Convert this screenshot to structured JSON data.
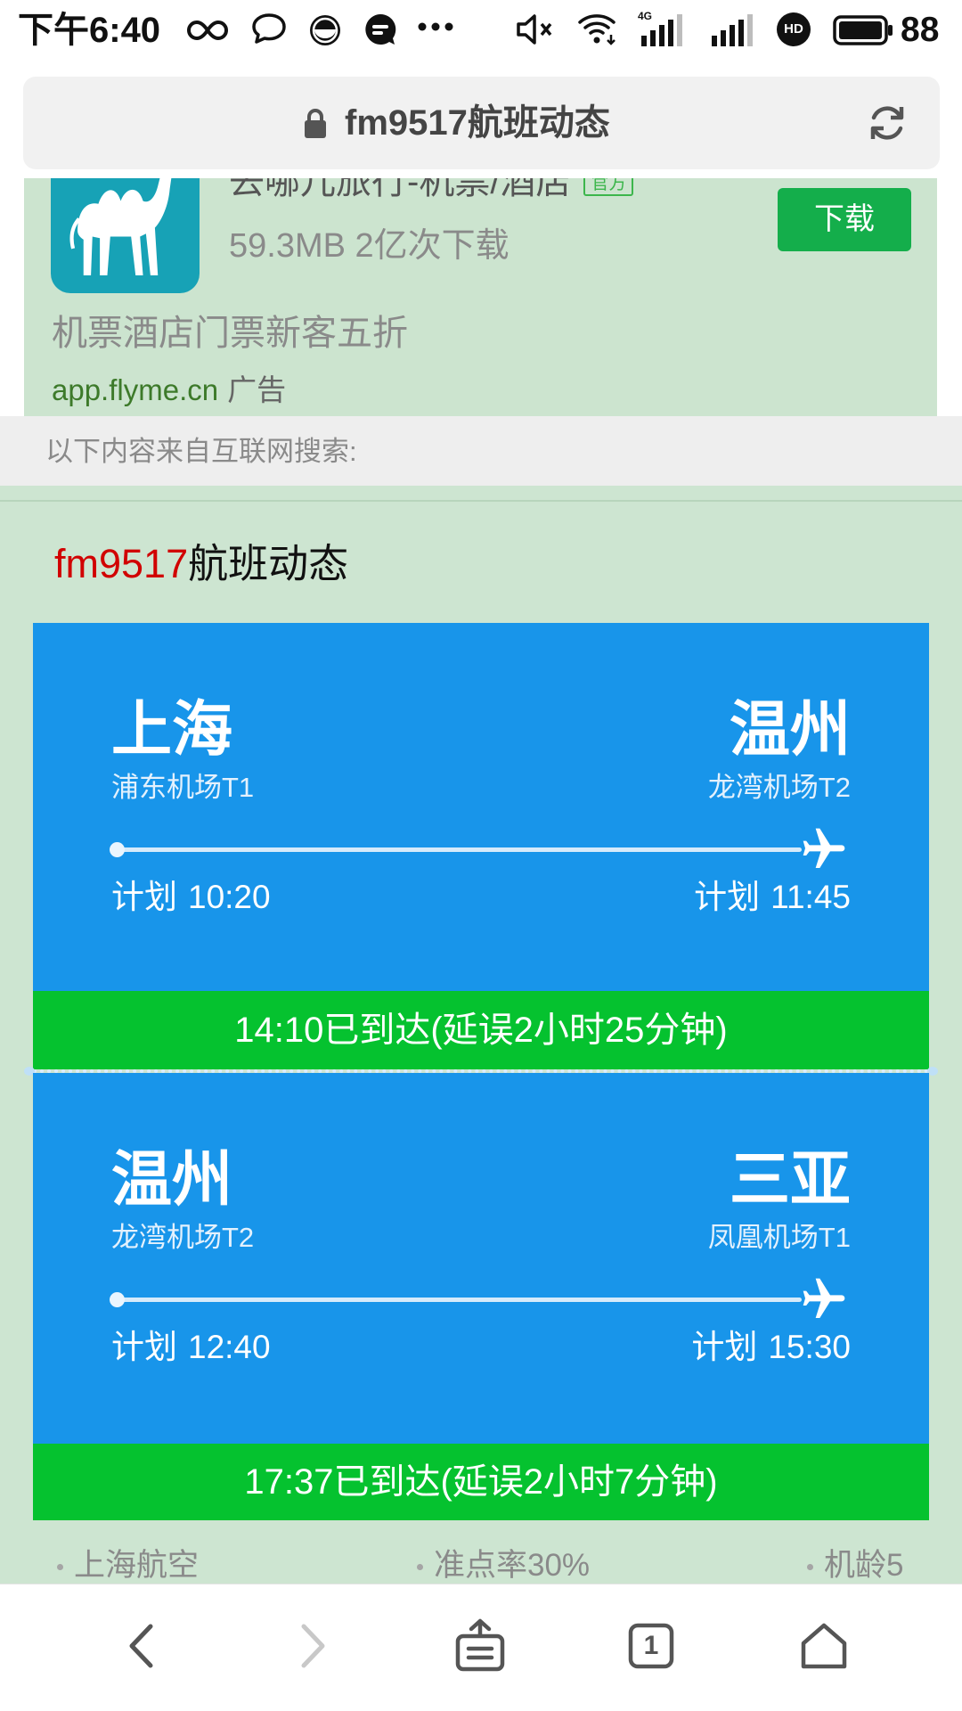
{
  "status_bar": {
    "time": "下午6:40",
    "network": "4G",
    "hd_label": "HD",
    "battery_level": "88",
    "icons_left": [
      "infinity-icon",
      "chat-bubble-icon",
      "smiley-icon",
      "message-icon",
      "more-dots-icon"
    ],
    "icons_right": [
      "mute-icon",
      "wifi-icon",
      "signal-4g-icon",
      "signal-icon",
      "hd-icon",
      "battery-icon"
    ]
  },
  "url_bar": {
    "title": "fm9517航班动态",
    "icons": [
      "lock-icon",
      "refresh-icon"
    ]
  },
  "ad": {
    "app_name": "去哪儿旅行-机票/酒店",
    "badge": "官方",
    "meta": "59.3MB 2亿次下载",
    "download_label": "下载",
    "slogan": "机票酒店门票新客五折",
    "source": "app.flyme.cn",
    "ad_label": "广告",
    "icon": "camel-icon"
  },
  "notice": "以下内容来自互联网搜索:",
  "flight": {
    "code": "fm9517",
    "title_suffix": "航班动态",
    "legs": [
      {
        "from": {
          "city": "上海",
          "airport": "浦东机场T1"
        },
        "to": {
          "city": "温州",
          "airport": "龙湾机场T2"
        },
        "departure": {
          "label": "计划",
          "time": "10:20"
        },
        "arrival": {
          "label": "计划",
          "time": "11:45"
        },
        "status": "14:10已到达(延误2小时25分钟)"
      },
      {
        "from": {
          "city": "温州",
          "airport": "龙湾机场T2"
        },
        "to": {
          "city": "三亚",
          "airport": "凤凰机场T1"
        },
        "departure": {
          "label": "计划",
          "time": "12:40"
        },
        "arrival": {
          "label": "计划",
          "time": "15:30"
        },
        "status": "17:37已到达(延误2小时7分钟)"
      }
    ],
    "info": [
      "上海航空",
      "准点率30%",
      "机龄5"
    ]
  },
  "bottom_nav": {
    "tab_count": "1",
    "icons": [
      "back-icon",
      "forward-icon",
      "share-icon",
      "tabs-icon",
      "home-icon"
    ]
  },
  "colors": {
    "card_blue": "#1895ea",
    "status_green": "#05c22f",
    "page_green": "#cde5d1",
    "ad_green": "#cce4cf",
    "code_red": "#d10000",
    "download_green": "#14ae4b",
    "app_icon_teal": "#17a2b6"
  }
}
